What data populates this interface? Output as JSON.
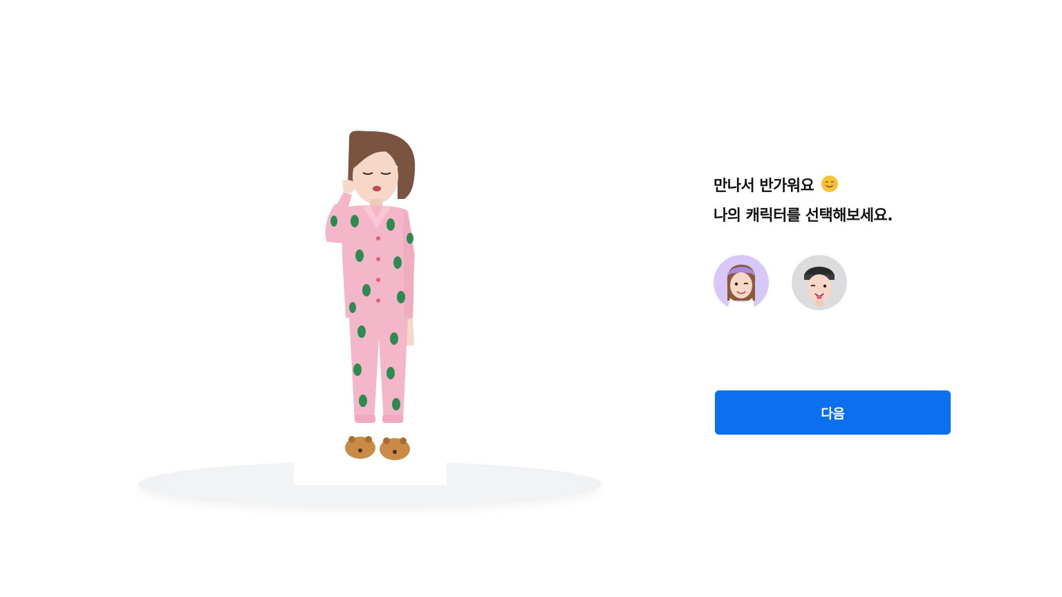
{
  "greeting": {
    "line1": "만나서 반가워요",
    "line2": "나의 캐릭터를 선택해보세요.",
    "emoji_icon": "smiling-face-icon"
  },
  "characters": [
    {
      "name": "female-avatar",
      "icon": "female-character-icon",
      "bg": "#d8c8f8",
      "selected": true
    },
    {
      "name": "male-avatar",
      "icon": "male-character-icon",
      "bg": "#dcdcde",
      "selected": false
    }
  ],
  "next_button": {
    "label": "다음",
    "color": "#0b6ff0"
  },
  "colors": {
    "pajama": "#f3b7c9",
    "pattern": "#2f8a52",
    "hair": "#7a5440",
    "skin": "#f6d7c8",
    "slipper": "#c98b45"
  }
}
